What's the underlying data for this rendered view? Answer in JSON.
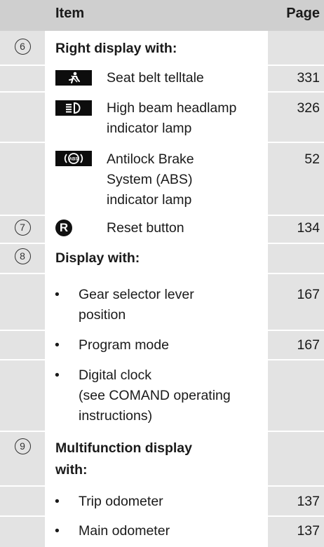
{
  "header": {
    "item_label": "Item",
    "page_label": "Page"
  },
  "sections": {
    "s6": {
      "number": "6",
      "title": "Right display with:",
      "rows": [
        {
          "icon": "seat-belt-icon",
          "text": "Seat belt telltale",
          "page": "331"
        },
        {
          "icon": "high-beam-icon",
          "text_lines": [
            "High beam headlamp",
            "indicator lamp"
          ],
          "page": "326"
        },
        {
          "icon": "abs-icon",
          "icon_label": "ABS",
          "text_lines": [
            "Antilock Brake",
            "System (ABS)",
            "indicator lamp"
          ],
          "page": "52"
        }
      ]
    },
    "s7": {
      "number": "7",
      "icon": "reset-r-icon",
      "icon_label": "R",
      "text": "Reset button",
      "page": "134"
    },
    "s8": {
      "number": "8",
      "title": "Display with:",
      "rows": [
        {
          "text_lines": [
            "Gear selector lever",
            "position"
          ],
          "page": "167"
        },
        {
          "text": "Program mode",
          "page": "167"
        },
        {
          "text_lines": [
            "Digital clock",
            "(see COMAND operating",
            "instructions)"
          ],
          "page": ""
        }
      ]
    },
    "s9": {
      "number": "9",
      "title_lines": [
        "Multifunction display",
        "with:"
      ],
      "rows": [
        {
          "text": "Trip odometer",
          "page": "137"
        },
        {
          "text": "Main odometer",
          "page": "137"
        }
      ]
    }
  },
  "bullet_char": "•"
}
